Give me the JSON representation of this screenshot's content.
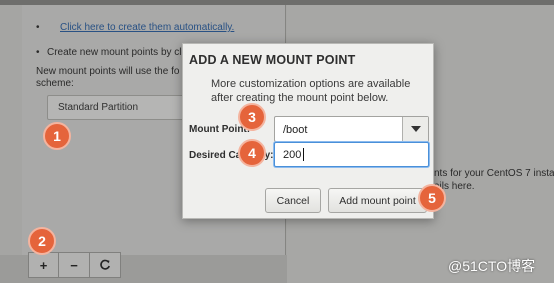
{
  "background": {
    "auto_link": "Click here to create them automatically.",
    "bullet_text": "Create new mount points by cl",
    "scheme_note_line1": "New mount points will use the fo",
    "scheme_note_line2": "scheme:",
    "scheme_select_value": "Standard Partition",
    "right_text_line1": "nts for your CentOS 7 insta",
    "right_text_line2": "ails here.",
    "toolbar": {
      "add_label": "+",
      "remove_label": "−",
      "refresh_icon": "refresh-icon"
    }
  },
  "dialog": {
    "title": "ADD A NEW MOUNT POINT",
    "description": "More customization options are available after creating the mount point below.",
    "mount_point_label": "Mount Point:",
    "mount_point_value": "/boot",
    "capacity_label": "Desired Capacity:",
    "capacity_value": "200",
    "cancel_label": "Cancel",
    "add_label": "Add mount point"
  },
  "markers": [
    "1",
    "2",
    "3",
    "4",
    "5"
  ],
  "watermark": "@51CTO博客",
  "colors": {
    "marker": "#e5643b",
    "link": "#2a62a8",
    "focus": "#4a90d9"
  }
}
